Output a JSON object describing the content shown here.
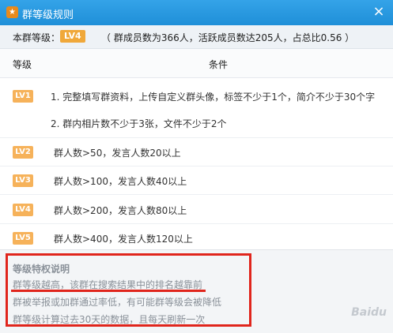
{
  "window": {
    "icon": "group-level-icon",
    "title": "群等级规则",
    "close_label": "×"
  },
  "summary": {
    "label": "本群等级：",
    "current_level": "LV4",
    "stats": "（ 群成员数为366人，活跃成员数达205人，占总比0.56 ）"
  },
  "table": {
    "headers": [
      "等级",
      "条件"
    ],
    "rows": [
      {
        "level": "LV1",
        "conditions": [
          "1. 完整填写群资料，上传自定义群头像，标签不少于1个，简介不少于30个字",
          "2. 群内相片数不少于3张，文件不少于2个"
        ]
      },
      {
        "level": "LV2",
        "conditions": [
          "群人数>50，发言人数20以上"
        ]
      },
      {
        "level": "LV3",
        "conditions": [
          "群人数>100，发言人数40以上"
        ]
      },
      {
        "level": "LV4",
        "conditions": [
          "群人数>200，发言人数80以上"
        ]
      },
      {
        "level": "LV5",
        "conditions": [
          "群人数>400，发言人数120以上"
        ]
      }
    ]
  },
  "info": {
    "title": "等级特权说明",
    "lines": [
      "群等级越高，该群在搜索结果中的排名越靠前",
      "群被举报或加群通过率低，有可能群等级会被降低",
      "群等级计算过去30天的数据，且每天刷新一次"
    ],
    "highlight_color": "#e0251c"
  },
  "watermark": "Baidu"
}
